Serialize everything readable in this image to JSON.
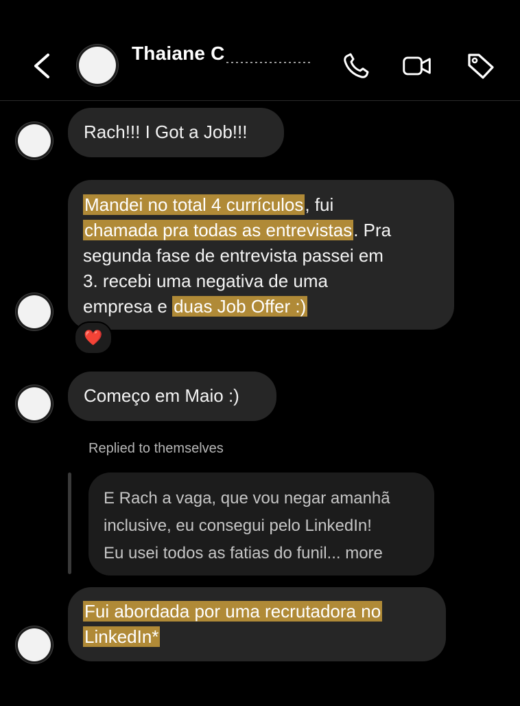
{
  "header": {
    "contact_name": "Thaiane C",
    "icons": [
      "back-icon",
      "phone-icon",
      "video-camera-icon",
      "tag-icon"
    ]
  },
  "messages": [
    {
      "text": "Rach!!! I Got a Job!!!"
    },
    {
      "lines": [
        {
          "hl": "Mandei no total 4 currículos",
          "rest": ", fui"
        },
        {
          "hl": "chamada pra todas as entrevistas",
          "rest": ". Pra"
        },
        {
          "text": "segunda fase de entrevista passei em"
        },
        {
          "text": "3. recebi uma negativa de uma"
        },
        {
          "pre": "empresa e ",
          "hl": "duas Job Offer :)"
        }
      ],
      "reaction": "❤️"
    },
    {
      "text": "Começo em Maio :)"
    }
  ],
  "reply": {
    "label": "Replied to themselves",
    "lines": [
      "E Rach a vaga, que vou negar amanhã",
      "inclusive, eu consegui pelo LinkedIn!",
      "Eu usei todos as fatias do funil... more"
    ]
  },
  "last_message": {
    "line1": "Fui abordada por uma recrutadora no",
    "line2": "LinkedIn*"
  },
  "colors": {
    "background": "#000000",
    "bubble": "#262626",
    "highlight": "#b08a37"
  }
}
